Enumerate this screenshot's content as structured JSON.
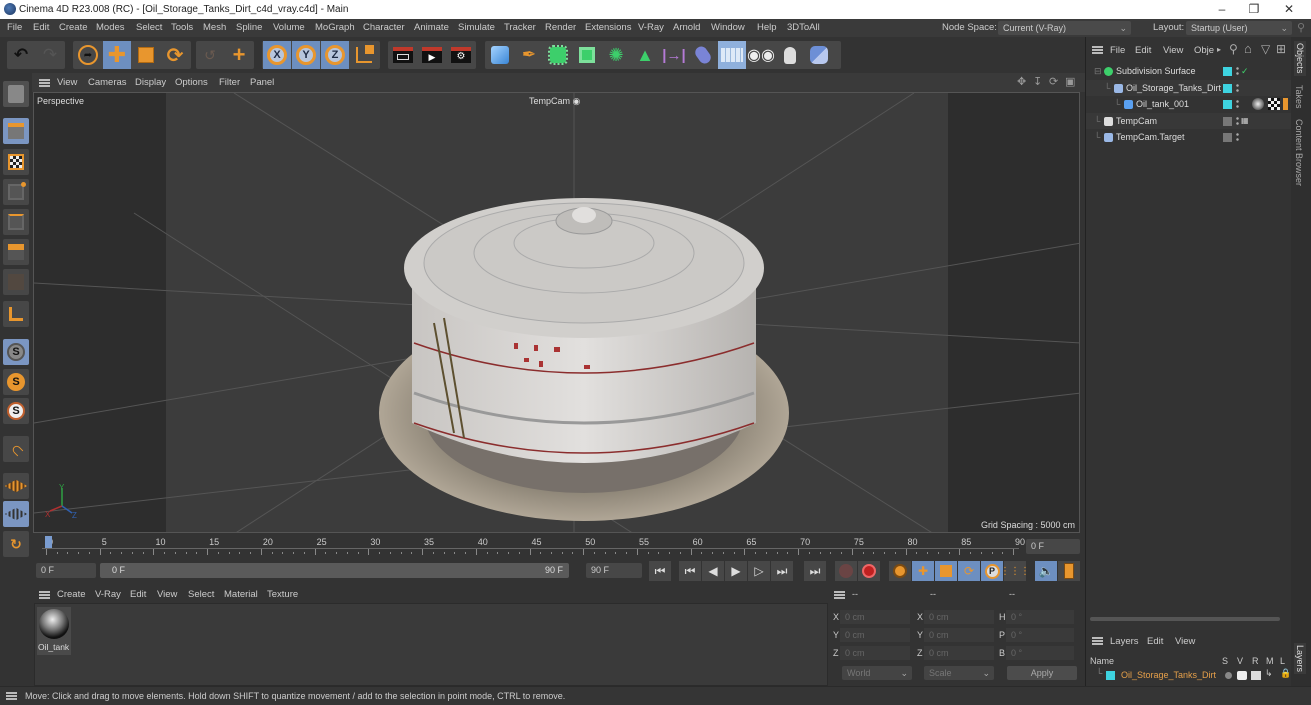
{
  "window": {
    "title": "Cinema 4D R23.008 (RC) - [Oil_Storage_Tanks_Dirt_c4d_vray.c4d] - Main",
    "controls": [
      "minimize",
      "restore",
      "close"
    ]
  },
  "menubar": {
    "items": [
      "File",
      "Edit",
      "Create",
      "Modes",
      "Select",
      "Tools",
      "Mesh",
      "Spline",
      "Volume",
      "MoGraph",
      "Character",
      "Animate",
      "Simulate",
      "Tracker",
      "Render",
      "Extensions",
      "V-Ray",
      "Arnold",
      "Window",
      "Help",
      "3DToAll"
    ],
    "node_space_label": "Node Space:",
    "node_space_value": "Current (V-Ray)",
    "layout_label": "Layout:",
    "layout_value": "Startup (User)"
  },
  "toolbar": {
    "groups": [
      [
        "undo-icon",
        "redo-icon"
      ],
      [
        "live-selection-icon",
        "move-icon",
        "scale-icon",
        "rotate-icon"
      ],
      [
        "recent-tool-icon",
        "add-tool-icon"
      ],
      [
        "lock-x-icon",
        "lock-y-icon",
        "lock-z-icon",
        "coordinate-system-icon"
      ],
      [
        "render-view-icon",
        "render-picture-viewer-icon",
        "render-settings-icon"
      ],
      [
        "cube-icon",
        "pen-spline-icon",
        "subdivision-icon",
        "extrude-icon",
        "cloner-icon",
        "array-icon",
        "deformer-icon",
        "field-icon",
        "floor-icon",
        "camera-icon",
        "light-icon",
        "python-icon"
      ]
    ],
    "axis_labels": [
      "X",
      "Y",
      "Z"
    ]
  },
  "left_toolbar": {
    "items": [
      "make-editable-icon",
      "model-mode-icon",
      "texture-mode-icon",
      "point-mode-icon",
      "edge-mode-icon",
      "polygon-mode-icon",
      "uv-mode-icon",
      "axis-mode-icon",
      "solo-off-icon",
      "solo-single-icon",
      "solo-hierarchy-icon",
      "snap-icon",
      "workplane-icon",
      "locked-workplane-icon",
      "workplane-rotate-icon"
    ]
  },
  "viewport": {
    "menu": [
      "View",
      "Cameras",
      "Display",
      "Options",
      "Filter",
      "Panel"
    ],
    "name": "Perspective",
    "camera": "TempCam",
    "grid_spacing": "Grid Spacing : 5000 cm",
    "axis": {
      "x": "X",
      "y": "Y",
      "z": "Z"
    }
  },
  "timeline": {
    "ticks": [
      "0",
      "5",
      "10",
      "15",
      "20",
      "25",
      "30",
      "35",
      "40",
      "45",
      "50",
      "55",
      "60",
      "65",
      "70",
      "75",
      "80",
      "85",
      "90"
    ],
    "current_frame": "0 F",
    "start_field": "0 F",
    "range_start": "0 F",
    "range_end": "90 F",
    "end_field": "90 F",
    "playhead_frame": 0,
    "max_frame": 90
  },
  "playback": {
    "buttons": [
      "go-to-start",
      "prev-key",
      "prev-frame",
      "play",
      "next-frame",
      "next-key",
      "go-to-end"
    ],
    "record_buttons": [
      "autokey",
      "record"
    ],
    "key_buttons": [
      "keyframe-selection",
      "position-key",
      "scale-key",
      "rotation-key",
      "parameter-key",
      "point-level-anim"
    ],
    "extra_buttons": [
      "sound",
      "timeline-window"
    ]
  },
  "material_panel": {
    "menu": [
      "Create",
      "V-Ray",
      "Edit",
      "View",
      "Select",
      "Material",
      "Texture"
    ],
    "materials": [
      {
        "name": "Oil_tank"
      }
    ]
  },
  "coord_panel": {
    "headers": [
      "--",
      "--",
      "--"
    ],
    "rows": [
      {
        "l1": "X",
        "v1": "0 cm",
        "l2": "X",
        "v2": "0 cm",
        "l3": "H",
        "v3": "0 °"
      },
      {
        "l1": "Y",
        "v1": "0 cm",
        "l2": "Y",
        "v2": "0 cm",
        "l3": "P",
        "v3": "0 °"
      },
      {
        "l1": "Z",
        "v1": "0 cm",
        "l2": "Z",
        "v2": "0 cm",
        "l3": "B",
        "v3": "0 °"
      }
    ],
    "mode": "World",
    "transform": "Scale",
    "apply": "Apply"
  },
  "object_panel": {
    "menu": [
      "File",
      "Edit",
      "View",
      "Obje"
    ],
    "objects": [
      {
        "name": "Subdivision Surface",
        "indent": 0,
        "icon": "subdivision-icon",
        "layer": true,
        "check": true
      },
      {
        "name": "Oil_Storage_Tanks_Dirt",
        "indent": 1,
        "icon": "null-icon",
        "layer": true
      },
      {
        "name": "Oil_tank_001",
        "indent": 2,
        "icon": "polygon-icon",
        "layer": true,
        "tags": true
      },
      {
        "name": "TempCam",
        "indent": 0,
        "icon": "camera-icon",
        "layer": false
      },
      {
        "name": "TempCam.Target",
        "indent": 0,
        "icon": "null-icon",
        "layer": false
      }
    ]
  },
  "layer_panel": {
    "menu": [
      "Layers",
      "Edit",
      "View"
    ],
    "columns": [
      "Name",
      "S",
      "V",
      "R",
      "M",
      "L"
    ],
    "layers": [
      {
        "name": "Oil_Storage_Tanks_Dirt",
        "color": "#3ed3e0"
      }
    ]
  },
  "side_tabs": [
    "Objects",
    "Takes",
    "Content Browser"
  ],
  "side_tabs_bottom": [
    "Layers"
  ],
  "status": "Move: Click and drag to move elements. Hold down SHIFT to quantize movement / add to the selection in point mode, CTRL to remove.",
  "colors": {
    "accent_orange": "#e8962e",
    "selection_blue": "#6d8fc0",
    "layer_cyan": "#3ed3e0",
    "layer_name": "#e6a04a"
  }
}
